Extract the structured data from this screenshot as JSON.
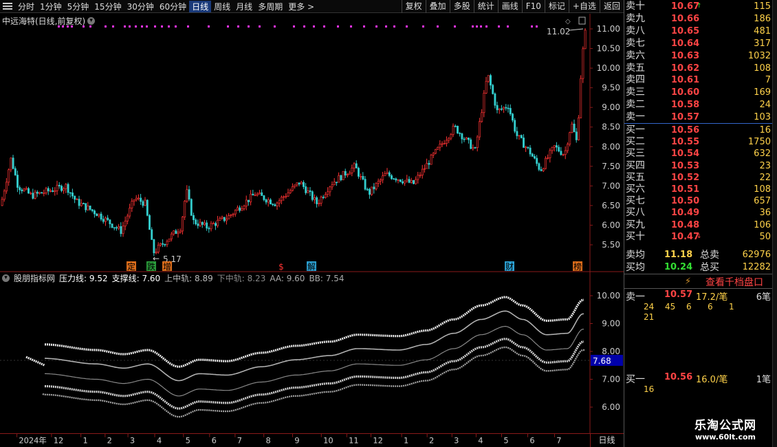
{
  "toolbar": {
    "periods": [
      "分时",
      "1分钟",
      "5分钟",
      "15分钟",
      "30分钟",
      "60分钟",
      "日线",
      "周线",
      "月线",
      "多周期",
      "更多 >"
    ],
    "active_period": "日线",
    "buttons": [
      "复权",
      "叠加",
      "多股",
      "统计",
      "画线",
      "F10",
      "标记",
      "+自选",
      "返回"
    ]
  },
  "chart": {
    "title": "中远海特(日线,前复权)",
    "high_label": "11.02",
    "low_label": "5.17",
    "price_axis": [
      "11.00",
      "10.50",
      "10.00",
      "9.50",
      "9.00",
      "8.50",
      "8.00",
      "7.50",
      "7.00",
      "6.50",
      "6.00",
      "5.50"
    ],
    "events": [
      {
        "label": "定",
        "color": "#d86b1a"
      },
      {
        "label": "跌",
        "color": "#2a9a3a"
      },
      {
        "label": "增",
        "color": "#d86b1a"
      },
      {
        "label": "$",
        "color": "#ff3333"
      },
      {
        "label": "解",
        "color": "#2b9fd0"
      },
      {
        "label": "财",
        "color": "#2b9fd0"
      },
      {
        "label": "榜",
        "color": "#d86b1a"
      }
    ]
  },
  "indicator": {
    "name": "股朋指标网",
    "values": [
      {
        "label": "压力线: 9.52",
        "color": "#ffffff"
      },
      {
        "label": "支撑线: 7.60",
        "color": "#ffffff"
      },
      {
        "label": "上中轨: 8.89",
        "color": "#bbbbbb"
      },
      {
        "label": "下中轨: 8.23",
        "color": "#888888"
      },
      {
        "label": "AA: 9.60",
        "color": "#aaaaaa"
      },
      {
        "label": "BB: 7.54",
        "color": "#aaaaaa"
      }
    ],
    "axis": [
      "10.00",
      "9.00",
      "8.00",
      "7.00",
      "6.00"
    ],
    "cursor_value": "7.68"
  },
  "date_axis": {
    "labels": [
      "2024年",
      "12",
      "1",
      "2",
      "3",
      "4",
      "5",
      "6",
      "7",
      "8",
      "9",
      "10",
      "11",
      "12",
      "1",
      "2",
      "3",
      "4",
      "5",
      "6",
      "7"
    ],
    "period_label": "日线"
  },
  "order_book": {
    "asks": [
      {
        "label": "卖十",
        "price": "10.67",
        "vol": "115",
        "arrow": "↑"
      },
      {
        "label": "卖九",
        "price": "10.66",
        "vol": "186"
      },
      {
        "label": "卖八",
        "price": "10.65",
        "vol": "481"
      },
      {
        "label": "卖七",
        "price": "10.64",
        "vol": "317"
      },
      {
        "label": "卖六",
        "price": "10.63",
        "vol": "1032"
      },
      {
        "label": "卖五",
        "price": "10.62",
        "vol": "108"
      },
      {
        "label": "卖四",
        "price": "10.61",
        "vol": "7"
      },
      {
        "label": "卖三",
        "price": "10.60",
        "vol": "169"
      },
      {
        "label": "卖二",
        "price": "10.58",
        "vol": "24"
      },
      {
        "label": "卖一",
        "price": "10.57",
        "vol": "103"
      }
    ],
    "bids": [
      {
        "label": "买一",
        "price": "10.56",
        "vol": "16"
      },
      {
        "label": "买二",
        "price": "10.55",
        "vol": "1750"
      },
      {
        "label": "买三",
        "price": "10.54",
        "vol": "632"
      },
      {
        "label": "买四",
        "price": "10.53",
        "vol": "23"
      },
      {
        "label": "买五",
        "price": "10.52",
        "vol": "22"
      },
      {
        "label": "买六",
        "price": "10.51",
        "vol": "108"
      },
      {
        "label": "买七",
        "price": "10.50",
        "vol": "657"
      },
      {
        "label": "买八",
        "price": "10.49",
        "vol": "36"
      },
      {
        "label": "买九",
        "price": "10.48",
        "vol": "106"
      },
      {
        "label": "买十",
        "price": "10.47",
        "vol": "50",
        "arrow": "↓"
      }
    ],
    "summary": [
      {
        "label": "卖均",
        "price": "11.18",
        "price_color": "#ffd24a",
        "label2": "总卖",
        "vol": "62976"
      },
      {
        "label": "买均",
        "price": "10.24",
        "price_color": "#33dd33",
        "label2": "总买",
        "vol": "12282"
      }
    ],
    "qiandang_button": "查看千档盘口",
    "ask1_queue": {
      "label": "卖一",
      "price": "10.57",
      "avg": "17.2/笔",
      "count": "6笔",
      "orders": [
        "24",
        "45",
        "6",
        "6",
        "1",
        "21"
      ]
    },
    "bid1_queue": {
      "label": "买一",
      "price": "10.56",
      "avg": "16.0/笔",
      "count": "1笔",
      "orders": [
        "16"
      ]
    }
  },
  "watermark": {
    "title": "乐淘公式网",
    "url": "www.60lt.com"
  }
}
